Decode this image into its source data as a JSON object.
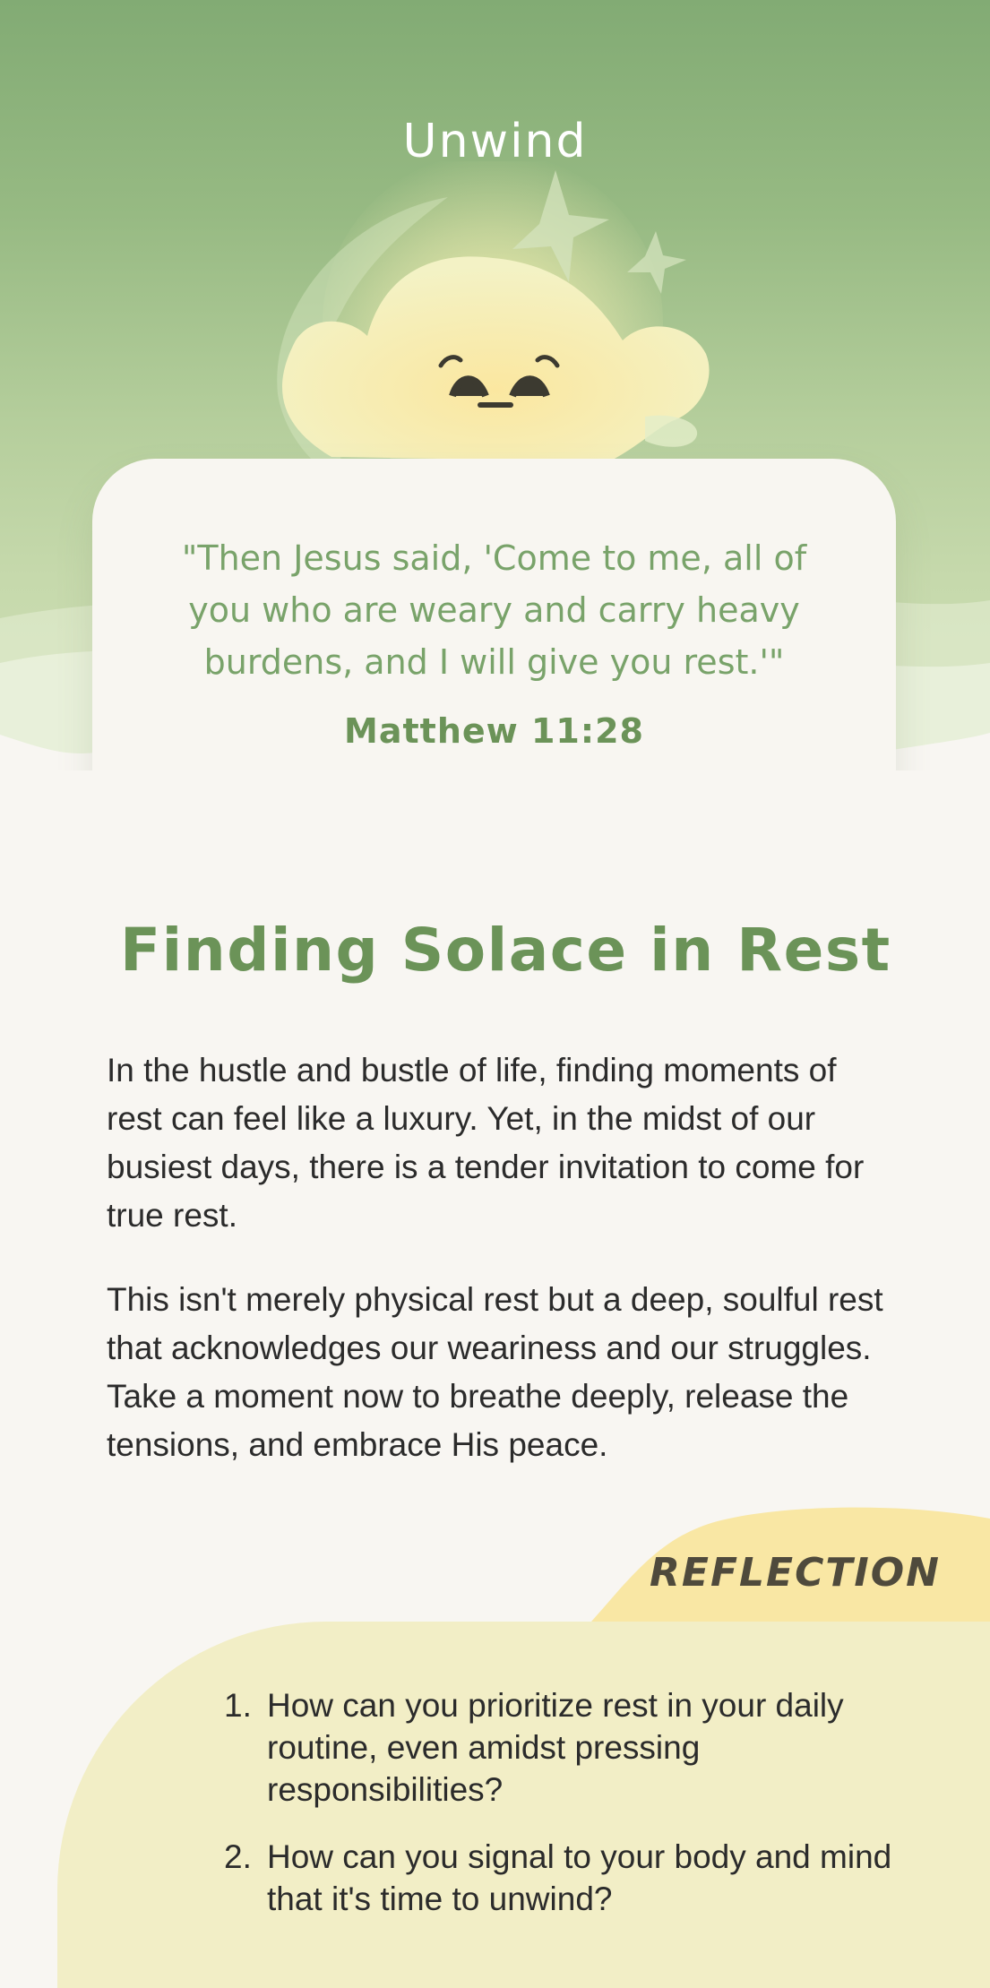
{
  "app": {
    "title": "Unwind"
  },
  "verse": {
    "text": "\"Then Jesus said, 'Come to me, all of you who are weary and carry heavy burdens, and I will give you rest.'\"",
    "reference": "Matthew 11:28"
  },
  "article": {
    "title": "Finding Solace in Rest",
    "paragraphs": [
      "In the hustle and bustle of life, finding moments of rest can feel like a luxury. Yet, in the midst of our busiest days, there is a tender invitation to come for true rest.",
      "This isn't merely physical rest but a deep, soulful rest that acknowledges our weariness and our struggles. Take a moment now to breathe deeply, release the tensions, and embrace His peace."
    ]
  },
  "reflection": {
    "label": "REFLECTION",
    "questions": [
      {
        "num": "1.",
        "text": "How can you prioritize rest in your daily routine, even amidst pressing responsibilities?"
      },
      {
        "num": "2.",
        "text": "How can you signal to your body and mind that it's time to unwind?"
      }
    ]
  },
  "colors": {
    "brand_green": "#6b9358",
    "quote_green": "#79a36a",
    "reflection_bg": "#f2eec6",
    "reflection_tab": "#f9e7a4"
  },
  "icons": {
    "mascot": "sleepy-cloud-moon-mascot",
    "stars": "sparkle-star-icon"
  }
}
